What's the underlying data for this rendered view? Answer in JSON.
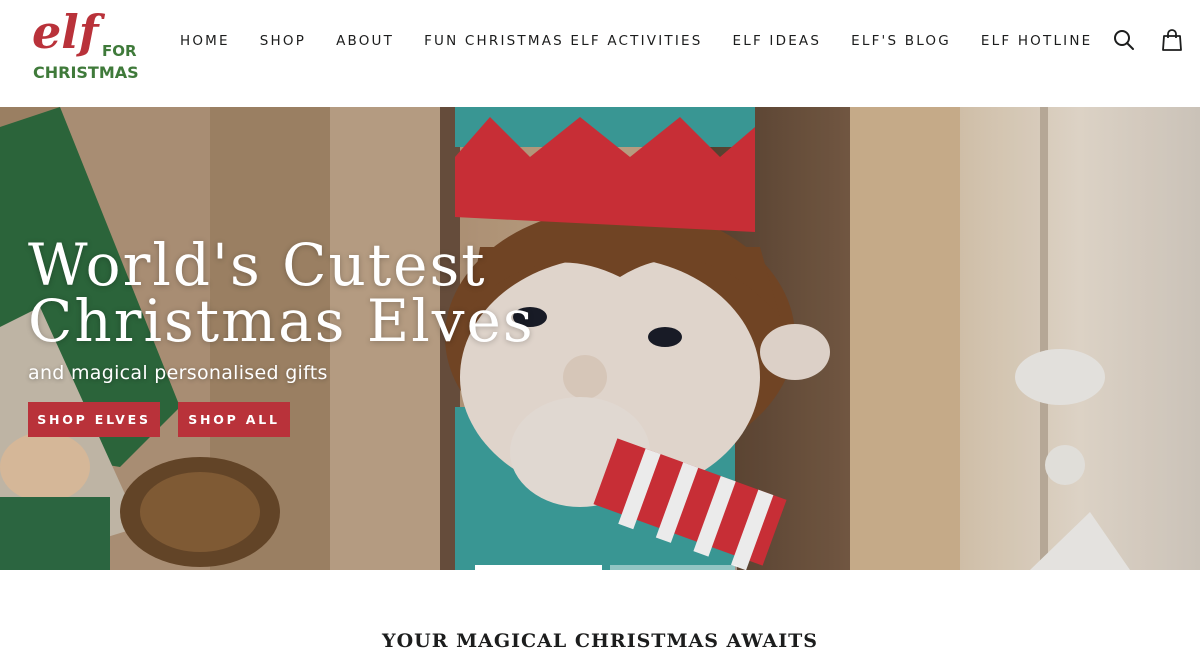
{
  "brand": {
    "logo_text_elf": "elf",
    "logo_text_for": "FOR",
    "logo_text_christmas": "CHRISTMAS",
    "elf_color": "#b9323a",
    "christmas_color": "#3f7a3a"
  },
  "nav": {
    "items": [
      {
        "label": "HOME"
      },
      {
        "label": "SHOP"
      },
      {
        "label": "ABOUT"
      },
      {
        "label": "FUN CHRISTMAS ELF ACTIVITIES"
      },
      {
        "label": "ELF IDEAS"
      },
      {
        "label": "ELF'S BLOG"
      },
      {
        "label": "ELF HOTLINE"
      }
    ]
  },
  "header_icons": {
    "search": "search-icon",
    "cart": "cart-icon"
  },
  "hero": {
    "title_line1": "World's Cutest",
    "title_line2": "Christmas Elves",
    "subtitle": "and magical personalised gifts",
    "btn_shop_elves": "SHOP ELVES",
    "btn_shop_all": "SHOP ALL",
    "button_color": "#b9323a",
    "slides": [
      {
        "active": true
      },
      {
        "active": false
      }
    ]
  },
  "section": {
    "title": "YOUR MAGICAL CHRISTMAS AWAITS"
  }
}
